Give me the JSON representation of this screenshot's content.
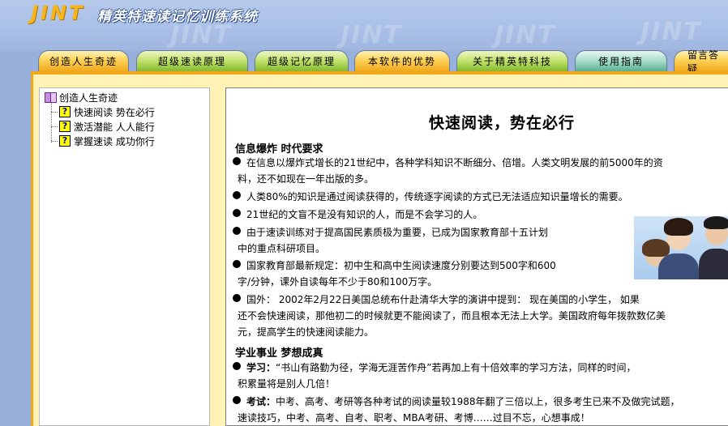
{
  "header": {
    "logo": "JINT",
    "app_title": "精英特速读记忆训练系统",
    "watermark": "JINT"
  },
  "tabs": [
    {
      "label": "创造人生奇迹",
      "color": "orange"
    },
    {
      "label": "超级速读原理",
      "color": "green"
    },
    {
      "label": "超级记忆原理",
      "color": "green"
    },
    {
      "label": "本软件的优势",
      "color": "orange"
    },
    {
      "label": "关于精英特科技",
      "color": "green"
    },
    {
      "label": "使用指南",
      "color": "teal"
    },
    {
      "label": "留言答疑",
      "color": "orange"
    }
  ],
  "tree": {
    "root": "创造人生奇迹",
    "items": [
      "快速阅读 势在必行",
      "激活潜能 人人能行",
      "掌握速读 成功你行"
    ]
  },
  "article": {
    "title": "快速阅读，势在必行",
    "sections": [
      {
        "heading": "信息爆炸 时代要求",
        "paragraphs": [
          {
            "line1": "在信息以爆炸式增长的21世纪中，各种学科知识不断细分、倍增。人类文明发展的前5000年的资",
            "line2": "料，还不如现在一年出版的多。"
          },
          {
            "line1": "人类80%的知识是通过阅读获得的，传统逐字阅读的方式已无法适应知识量增长的需要。",
            "line2": ""
          },
          {
            "line1": "21世纪的文盲不是没有知识的人，而是不会学习的人。",
            "line2": ""
          },
          {
            "line1": "由于速读训练对于提高国民素质极为重要，已成为国家教育部十五计划",
            "line2": "中的重点科研项目。"
          },
          {
            "line1": "国家教育部最新规定：初中生和高中生阅读速度分别要达到500字和600",
            "line2": "字/分钟，课外自读每年不少于80和100万字。"
          },
          {
            "line1": "国外： 2002年2月22日美国总统布什赴清华大学的演讲中提到： 现在美国的小学生， 如果",
            "line2": "还不会快速阅读，那他初二的时候就更不能阅读了，而且根本无法上大学。美国政府每年拨款数亿美",
            "line3": "元，提高学生的快速阅读能力。"
          }
        ]
      },
      {
        "heading": "学业事业 梦想成真",
        "paragraphs": [
          {
            "label": "学习：",
            "line1": "“书山有路勤为径，学海无涯苦作舟”若再加上有十倍效率的学习方法，同样的时间，",
            "line2": "积累量将是别人几倍！"
          },
          {
            "label": "考试：",
            "line1": "中考、高考、考研等各种考试的阅读量较1988年翻了三倍以上，很多考生已来不及做完试题，",
            "line2": "速读技巧，中考、高考、自考、职考、MBA考研、考博……过目不忘，心想事成！"
          }
        ]
      }
    ]
  },
  "colors": {
    "background": "#98b1dc",
    "frame": "#fff2b4",
    "tab_orange": "#f1a81d",
    "tab_green": "#86b72d",
    "tab_teal": "#56b091",
    "logo": "#f6b51c"
  }
}
